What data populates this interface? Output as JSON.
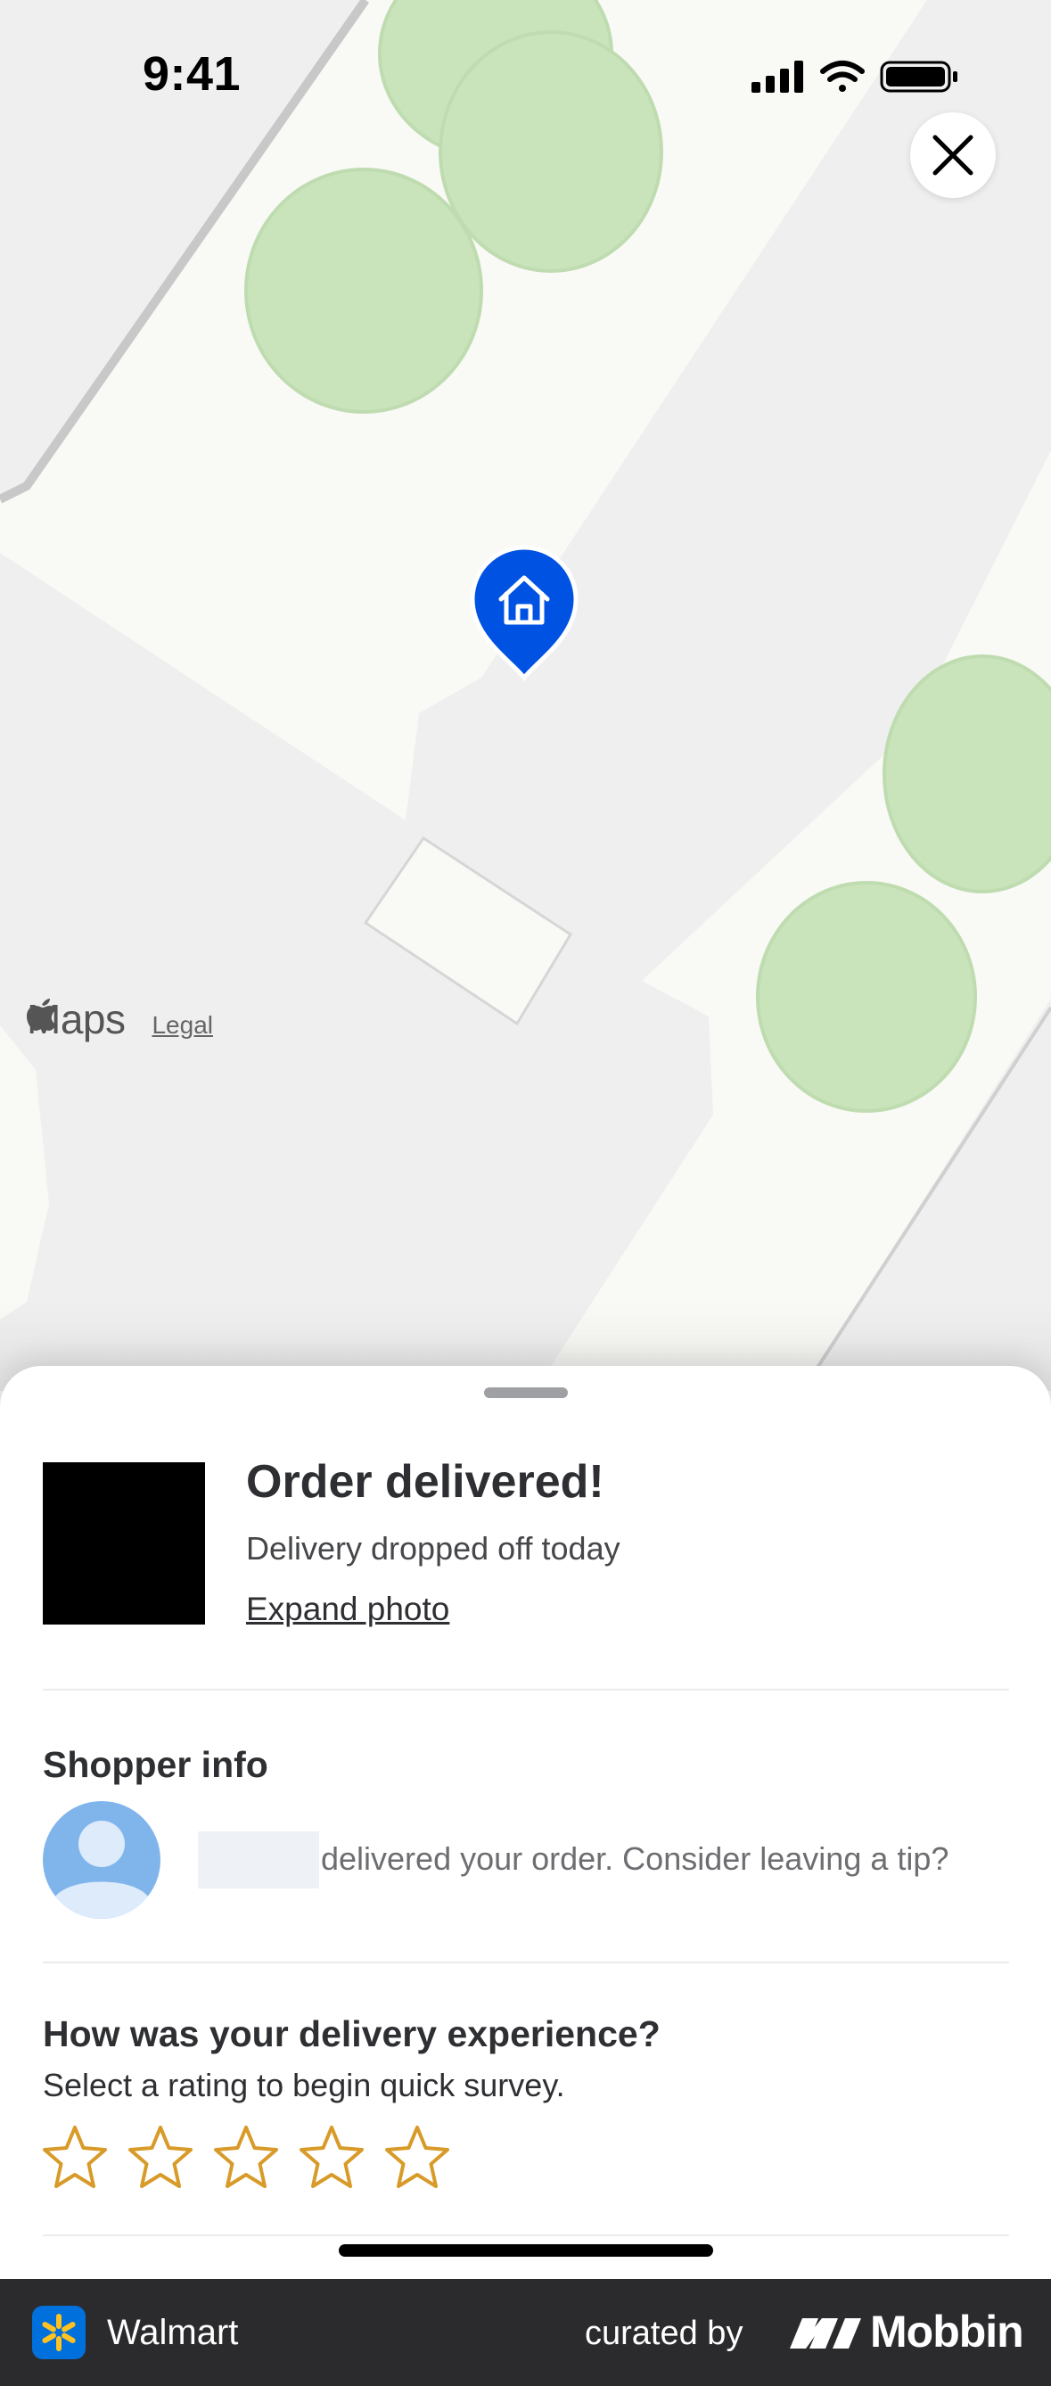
{
  "status_bar": {
    "time": "9:41"
  },
  "map": {
    "attribution_brand": "Maps",
    "legal_label": "Legal",
    "pin_icon": "home-icon",
    "pin_color": "#0053e2"
  },
  "close_icon": "close-icon",
  "delivery": {
    "title": "Order delivered!",
    "subtitle": "Delivery dropped off today",
    "expand_photo_label": "Expand photo"
  },
  "shopper": {
    "heading": "Shopper info",
    "message": "delivered your order. Consider leaving a tip?",
    "avatar_icon": "person-icon"
  },
  "survey": {
    "heading": "How was your delivery experience?",
    "subheading": "Select a rating to begin quick survey.",
    "star_count": 5,
    "star_color": "#d89a28"
  },
  "footer": {
    "app_name": "Walmart",
    "curated_by": "curated by",
    "brand": "Mobbin"
  }
}
